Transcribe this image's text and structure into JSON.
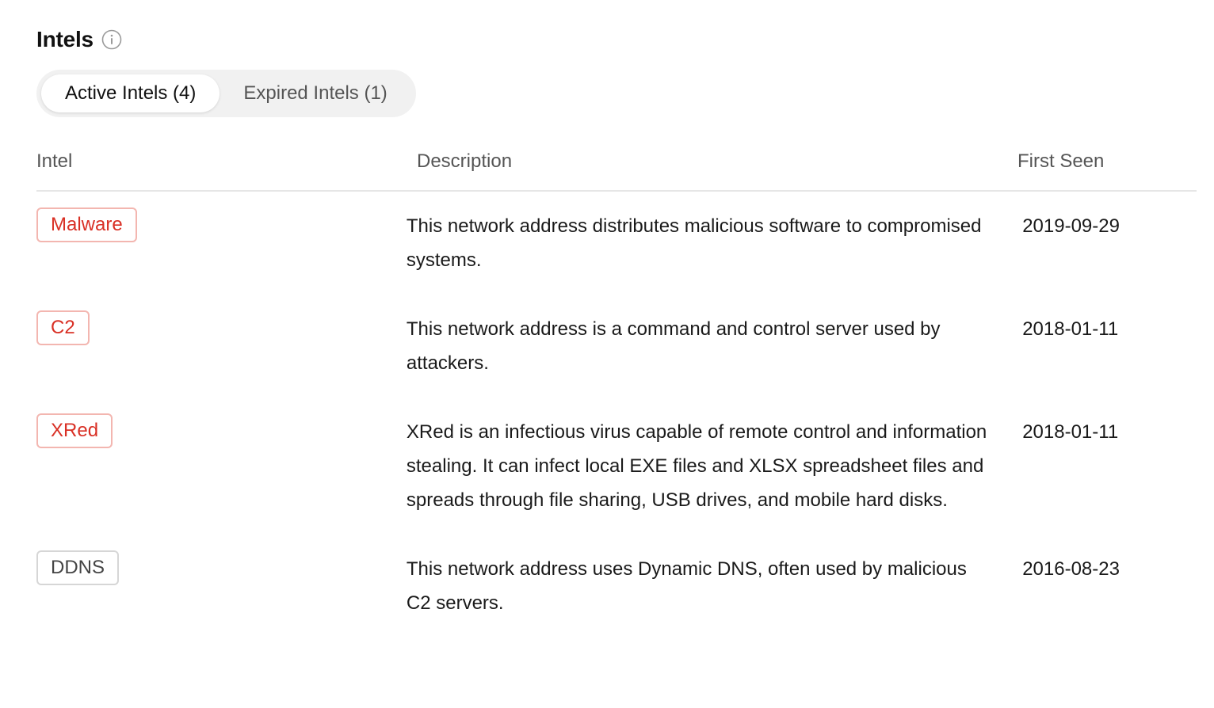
{
  "section": {
    "title": "Intels",
    "info_icon": "info-circle-icon"
  },
  "tabs": [
    {
      "label": "Active Intels (4)",
      "active": true
    },
    {
      "label": "Expired Intels (1)",
      "active": false
    }
  ],
  "table": {
    "columns": [
      "Intel",
      "Description",
      "First Seen"
    ],
    "rows": [
      {
        "tag": "Malware",
        "tag_style": "danger",
        "description": "This network address distributes malicious software to compromised systems.",
        "first_seen": "2019-09-29"
      },
      {
        "tag": "C2",
        "tag_style": "danger",
        "description": "This network address is a command and control server used by attackers.",
        "first_seen": "2018-01-11"
      },
      {
        "tag": "XRed",
        "tag_style": "danger",
        "description": "XRed is an infectious virus capable of remote control and information stealing. It can infect local EXE files and XLSX spreadsheet files and spreads through file sharing, USB drives, and mobile hard disks.",
        "first_seen": "2018-01-11"
      },
      {
        "tag": "DDNS",
        "tag_style": "neutral",
        "description": "This network address uses Dynamic DNS, often used by malicious C2 servers.",
        "first_seen": "2016-08-23"
      }
    ]
  },
  "colors": {
    "danger_text": "#d93025",
    "danger_border": "#f3b6b0",
    "neutral_border": "#d6d6d6",
    "tab_track": "#f1f1f1"
  }
}
